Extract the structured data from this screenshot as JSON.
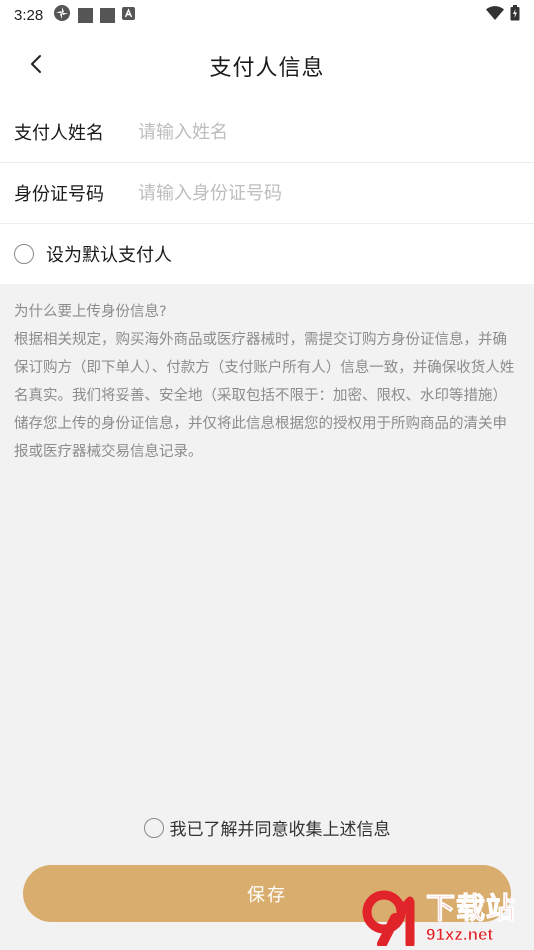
{
  "status_bar": {
    "time": "3:28",
    "left_icons": [
      "settings-gear-icon",
      "square-icon",
      "square-icon",
      "a-notification-icon"
    ],
    "right_icons": [
      "wifi-icon",
      "battery-icon"
    ]
  },
  "header": {
    "back_icon": "chevron-left-icon",
    "title": "支付人信息"
  },
  "form": {
    "name_label": "支付人姓名",
    "name_placeholder": "请输入姓名",
    "name_value": "",
    "id_label": "身份证号码",
    "id_placeholder": "请输入身份证号码",
    "id_value": ""
  },
  "default_option": {
    "label": "设为默认支付人",
    "checked": false
  },
  "info": {
    "title": "为什么要上传身份信息?",
    "body": "根据相关规定，购买海外商品或医疗器械时，需提交订购方身份证信息，并确保订购方（即下单人）、付款方（支付账户所有人）信息一致，并确保收货人姓名真实。我们将妥善、安全地（采取包括不限于：加密、限权、水印等措施）储存您上传的身份证信息，并仅将此信息根据您的授权用于所购商品的清关申报或医疗器械交易信息记录。"
  },
  "agreement": {
    "label": "我已了解并同意收集上述信息",
    "checked": false
  },
  "save_button": {
    "label": "保存"
  },
  "watermark": {
    "cn": "下载站",
    "url": "91xz.net"
  },
  "colors": {
    "accent": "#d8ad6e",
    "watermark_red": "#e0242a",
    "background": "#f2f2f2"
  }
}
